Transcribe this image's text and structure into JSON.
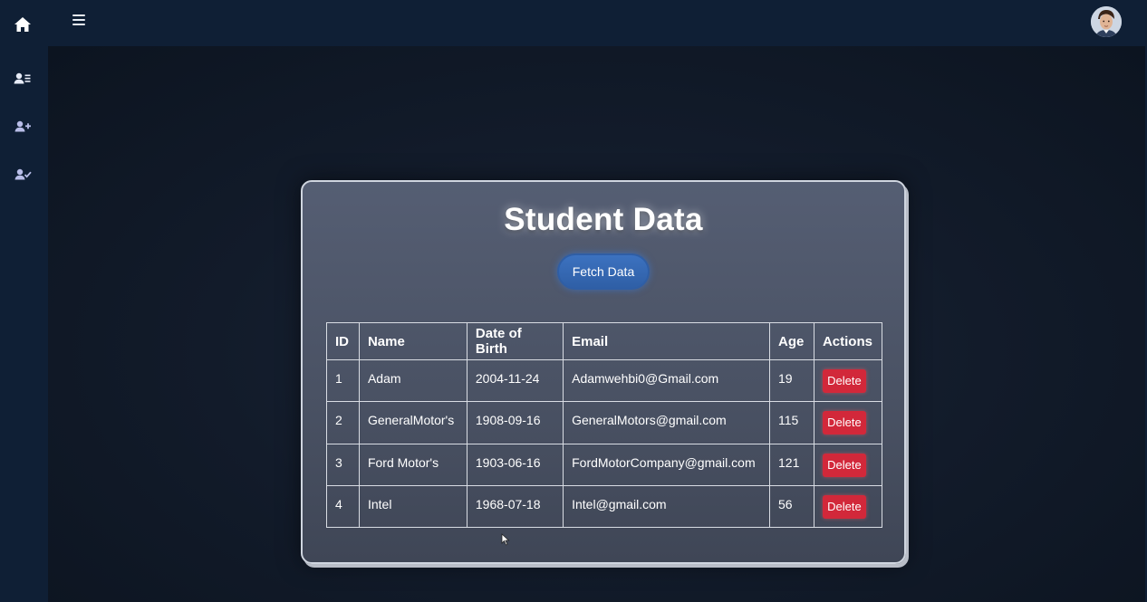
{
  "topbar": {
    "menu_icon": "hamburger-icon",
    "avatar_icon": "user-avatar"
  },
  "sidebar": {
    "items": [
      {
        "icon": "home-icon"
      },
      {
        "icon": "user-list-icon"
      },
      {
        "icon": "user-plus-icon"
      },
      {
        "icon": "user-check-icon"
      }
    ]
  },
  "card": {
    "title": "Student Data",
    "fetch_label": "Fetch Data"
  },
  "table": {
    "headers": [
      "ID",
      "Name",
      "Date of Birth",
      "Email",
      "Age",
      "Actions"
    ],
    "rows": [
      {
        "id": "1",
        "name": "Adam",
        "dob": "2004-11-24",
        "email": "Adamwehbi0@Gmail.com",
        "age": "19",
        "action": "Delete"
      },
      {
        "id": "2",
        "name": "GeneralMotor's",
        "dob": "1908-09-16",
        "email": "GeneralMotors@gmail.com",
        "age": "115",
        "action": "Delete"
      },
      {
        "id": "3",
        "name": "Ford Motor's",
        "dob": "1903-06-16",
        "email": "FordMotorCompany@gmail.com",
        "age": "121",
        "action": "Delete"
      },
      {
        "id": "4",
        "name": "Intel",
        "dob": "1968-07-18",
        "email": "Intel@gmail.com",
        "age": "56",
        "action": "Delete"
      }
    ]
  },
  "colors": {
    "sidebar_bg": "#0f1f35",
    "delete_button": "#d2283a",
    "fetch_button": "#2f5fa6"
  }
}
